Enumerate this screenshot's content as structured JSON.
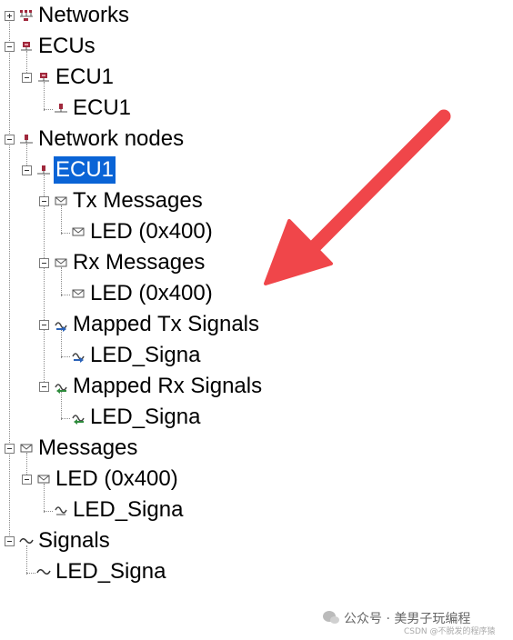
{
  "tree": {
    "networks": "Networks",
    "ecus": "ECUs",
    "ecus_ecu1": "ECU1",
    "ecus_ecu1_child": "ECU1",
    "network_nodes": "Network nodes",
    "node_ecu1": "ECU1",
    "tx_messages": "Tx Messages",
    "tx_led": "LED (0x400)",
    "rx_messages": "Rx Messages",
    "rx_led": "LED (0x400)",
    "mapped_tx": "Mapped Tx Signals",
    "mapped_tx_led": "LED_Signa",
    "mapped_rx": "Mapped Rx Signals",
    "mapped_rx_led": "LED_Signa",
    "messages": "Messages",
    "messages_led": "LED (0x400)",
    "messages_led_signal": "LED_Signa",
    "signals": "Signals",
    "signals_led": "LED_Signa"
  },
  "colors": {
    "selection": "#0a64d6",
    "arrow": "#f0464a",
    "ecu_icon": "#a0283c"
  },
  "watermark": {
    "text": "公众号 · 美男子玩编程",
    "sub": "CSDN @不脱发的程序猿"
  }
}
